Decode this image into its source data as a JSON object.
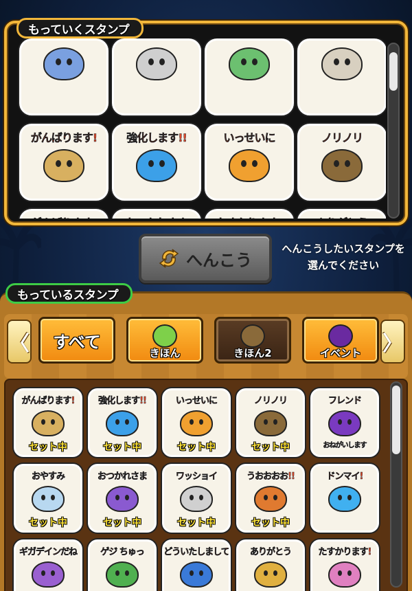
{
  "top_panel": {
    "title": "もっていくスタンプ",
    "stickers": [
      {
        "caption": "",
        "color": "#7aa0e0"
      },
      {
        "caption": "",
        "color": "#cfcfcf"
      },
      {
        "caption": "",
        "color": "#6cc070"
      },
      {
        "caption": "",
        "color": "#d8d0c0"
      },
      {
        "caption": "がんばります!",
        "color": "#d8b060"
      },
      {
        "caption": "強化します!!",
        "color": "#3ca0e8"
      },
      {
        "caption": "いっせいに",
        "color": "#f0a030"
      },
      {
        "caption": "ノリノリ",
        "color": "#8a6a3a"
      },
      {
        "caption": "がんばります!",
        "color": "#3a7ad8"
      },
      {
        "caption": "おつかれさま",
        "color": "#8a5ad0"
      },
      {
        "caption": "たすかります!",
        "color": "#e080c0"
      },
      {
        "caption": "ありがとう",
        "color": "#e0b040"
      }
    ]
  },
  "change_button": {
    "label": "へんこう"
  },
  "change_hint": {
    "line1": "へんこうしたいスタンプを",
    "line2": "選んでください"
  },
  "bottom_panel": {
    "title": "もっているスタンプ",
    "categories": [
      {
        "label": "すべて",
        "selected": false
      },
      {
        "label": "きほん",
        "selected": false
      },
      {
        "label": "きほん2",
        "selected": true
      },
      {
        "label": "イベント",
        "selected": false
      }
    ],
    "left_arrow": "〈",
    "right_arrow": "〉",
    "set_label": "セット中",
    "stickers": [
      {
        "caption": "がんばります!",
        "color": "#d8b060",
        "in_set": true
      },
      {
        "caption": "強化します!!",
        "color": "#3ca0e8",
        "in_set": true
      },
      {
        "caption": "いっせいに",
        "color": "#f0a030",
        "in_set": true
      },
      {
        "caption": "ノリノリ",
        "color": "#8a6a3a",
        "in_set": true
      },
      {
        "caption": "フレンド",
        "color": "#7a3ac0",
        "in_set": false,
        "sub": "おねがいします"
      },
      {
        "caption": "おやすみ",
        "color": "#b8d8f0",
        "in_set": true
      },
      {
        "caption": "おつかれさま",
        "color": "#8a5ad0",
        "in_set": true
      },
      {
        "caption": "ワッショイ",
        "color": "#d0d0d0",
        "in_set": true
      },
      {
        "caption": "うおおおお!!",
        "color": "#e07a30",
        "in_set": true
      },
      {
        "caption": "ドンマイ!",
        "color": "#40b0f0",
        "in_set": false
      },
      {
        "caption": "ギガデインだね",
        "color": "#9a60d0",
        "in_set": false
      },
      {
        "caption": "ゲジ ちゅっ",
        "color": "#50b050",
        "in_set": false
      },
      {
        "caption": "どういたしまして",
        "color": "#3a7ad8",
        "in_set": false
      },
      {
        "caption": "ありがとう",
        "color": "#e0b040",
        "in_set": false
      },
      {
        "caption": "たすかります!",
        "color": "#e080c0",
        "in_set": false
      }
    ]
  }
}
